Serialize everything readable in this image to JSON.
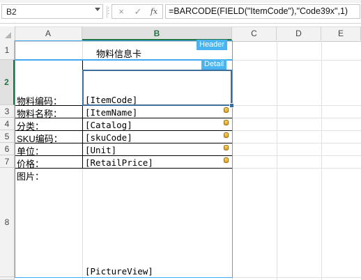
{
  "formula_bar": {
    "name_box": "B2",
    "cancel_icon": "×",
    "enter_icon": "✓",
    "function_icon": "fx",
    "formula": "=BARCODE(FIELD(\"ItemCode\"),\"Code39x\",1)"
  },
  "columns": [
    "A",
    "B",
    "C",
    "D",
    "E"
  ],
  "rows": [
    "1",
    "2",
    "3",
    "4",
    "5",
    "6",
    "7",
    "8"
  ],
  "cells": {
    "title": "物料信息卡",
    "labels": [
      "物料编码：",
      "物料名称：",
      "分类：",
      "SKU编码：",
      "单位：",
      "价格：",
      "图片："
    ],
    "fields": [
      "[ItemCode]",
      "[ItemName]",
      "[Catalog]",
      "[skuCode]",
      "[Unit]",
      "[RetailPrice]",
      "[PictureView]"
    ]
  },
  "ranges": {
    "header_tag": "Header",
    "detail_tag": "Detail"
  },
  "colors": {
    "range_border": "#3fa9f5",
    "tag_bg": "#4ab4f0",
    "selection": "#3c6e9e",
    "header_selected": "#217346"
  }
}
